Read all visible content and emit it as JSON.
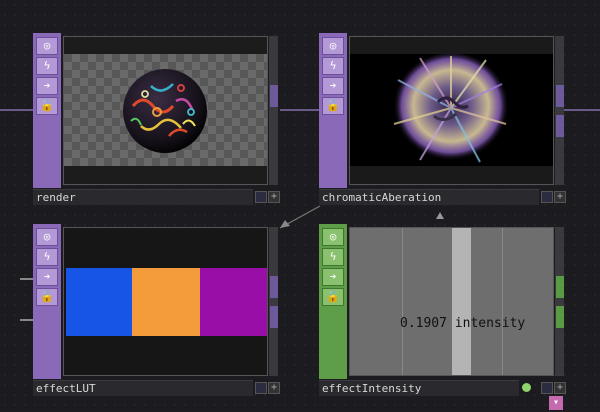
{
  "colors": {
    "top_accent": "#8a6ab8",
    "chop_accent": "#5e9e48",
    "lut_blue": "#1655e6",
    "lut_orange": "#f49b3c",
    "lut_purple": "#9a0ea8"
  },
  "sidebar_icons": [
    "target-icon",
    "lightning-icon",
    "arrow-right-icon",
    "lock-icon"
  ],
  "nodes": {
    "render": {
      "label": "render"
    },
    "chromatic": {
      "label": "chromaticAberation"
    },
    "lut": {
      "label": "effectLUT"
    },
    "intensity": {
      "label": "effectIntensity",
      "value": "0.1907",
      "channel": "intensity"
    }
  }
}
